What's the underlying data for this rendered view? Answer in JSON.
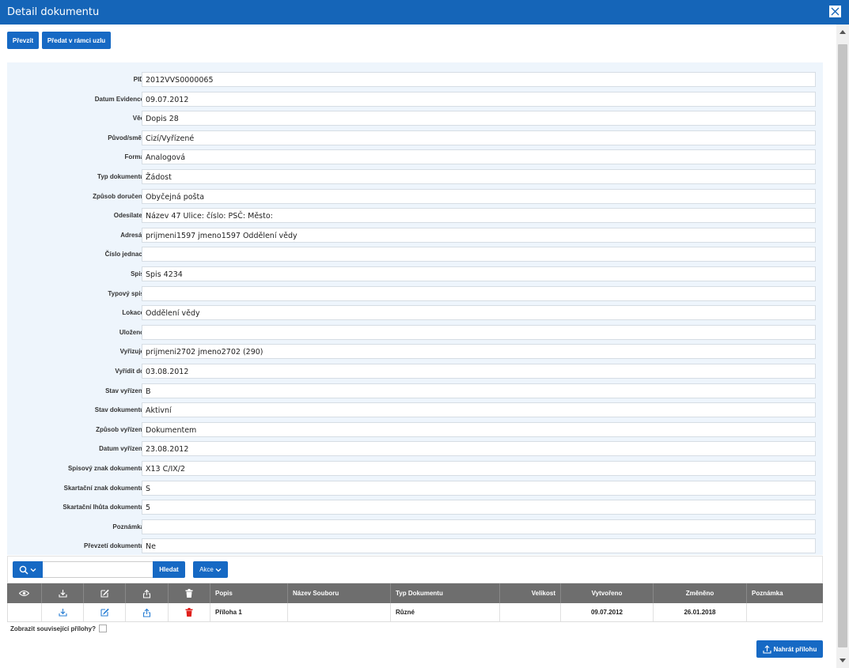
{
  "window": {
    "title": "Detail dokumentu"
  },
  "toolbar": {
    "take_over_label": "Převzít",
    "pass_label": "Předat v rámci uzlu"
  },
  "fields": [
    {
      "label": "PID",
      "value": "2012VVS0000065"
    },
    {
      "label": "Datum Evidence",
      "value": "09.07.2012"
    },
    {
      "label": "Věc",
      "value": "Dopis 28"
    },
    {
      "label": "Původ/směr",
      "value": "Cizí/Vyřízené"
    },
    {
      "label": "Forma",
      "value": "Analogová"
    },
    {
      "label": "Typ dokumentu",
      "value": "Žádost"
    },
    {
      "label": "Způsob doručení",
      "value": "Obyčejná pošta"
    },
    {
      "label": "Odesílatel",
      "value": "Název 47 Ulice: číslo: PSČ: Město:"
    },
    {
      "label": "Adresát",
      "value": "prijmeni1597 jmeno1597 Oddělení vědy"
    },
    {
      "label": "Číslo jednací",
      "value": ""
    },
    {
      "label": "Spis",
      "value": "Spis 4234"
    },
    {
      "label": "Typový spis",
      "value": ""
    },
    {
      "label": "Lokace",
      "value": "Oddělení vědy"
    },
    {
      "label": "Uloženo",
      "value": ""
    },
    {
      "label": "Vyřizuje",
      "value": "prijmeni2702 jmeno2702 (290)"
    },
    {
      "label": "Vyřídit do",
      "value": "03.08.2012"
    },
    {
      "label": "Stav vyřízení",
      "value": "B"
    },
    {
      "label": "Stav dokumentu",
      "value": "Aktivní"
    },
    {
      "label": "Způsob vyřízení",
      "value": "Dokumentem"
    },
    {
      "label": "Datum vyřízení",
      "value": "23.08.2012"
    },
    {
      "label": "Spisový znak dokumentu",
      "value": "X13 C/IX/2"
    },
    {
      "label": "Skartační znak dokumentu",
      "value": "S"
    },
    {
      "label": "Skartační lhůta dokumentu",
      "value": "5"
    },
    {
      "label": "Poznámka",
      "value": ""
    },
    {
      "label": "Převzetí dokumentu",
      "value": "Ne"
    }
  ],
  "attachments": {
    "search_value": "",
    "search_label": "Hledat",
    "actions_label": "Akce",
    "columns": {
      "popis": "Popis",
      "nazev": "Název Souboru",
      "typ": "Typ Dokumentu",
      "velikost": "Velikost",
      "vytvoreno": "Vytvořeno",
      "zmeneno": "Změněno",
      "poznamka": "Poznámka"
    },
    "rows": [
      {
        "popis": "Příloha 1",
        "nazev": "",
        "typ": "Různé",
        "velikost": "",
        "vytvoreno": "09.07.2012",
        "zmeneno": "26.01.2018",
        "poznamka": ""
      }
    ],
    "related_label": "Zobrazit související přílohy?",
    "upload_label": "Nahrát přílohu"
  },
  "colors": {
    "title_bar": "#1565b8",
    "button": "#1669c4",
    "panel": "#eef5fc",
    "grid_header": "#6e6e6e",
    "delete": "#e0201c",
    "row_icon": "#2a7fd4"
  },
  "icons": [
    "close-icon",
    "search-icon",
    "chevron-down-icon",
    "eye-icon",
    "download-icon",
    "edit-icon",
    "share-icon",
    "trash-icon",
    "upload-icon"
  ]
}
